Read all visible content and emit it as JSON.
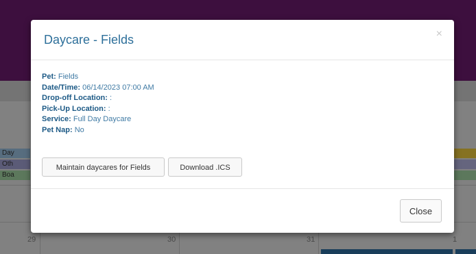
{
  "background": {
    "events_left": [
      "Day",
      "Oth",
      "Boa"
    ],
    "event_colors": [
      "#9fc6e8",
      "#a7a7d9",
      "#a8dba8"
    ],
    "event_colors_right": [
      "#f4d03f",
      "#b9b9e6",
      "#a8dba8"
    ],
    "day_numbers": [
      "29",
      "30",
      "31",
      "1"
    ]
  },
  "modal": {
    "title": "Daycare - Fields",
    "close_icon": "×",
    "details": [
      {
        "label": "Pet:",
        "value": "Fields"
      },
      {
        "label": "Date/Time:",
        "value": "06/14/2023 07:00 AM"
      },
      {
        "label": "Drop-off Location:",
        "value": ":"
      },
      {
        "label": "Pick-Up Location:",
        "value": ":"
      },
      {
        "label": "Service:",
        "value": "Full Day Daycare"
      },
      {
        "label": "Pet Nap:",
        "value": "No"
      }
    ],
    "maintain_button": "Maintain daycares for Fields",
    "download_button": "Download .ICS",
    "close_button": "Close"
  }
}
